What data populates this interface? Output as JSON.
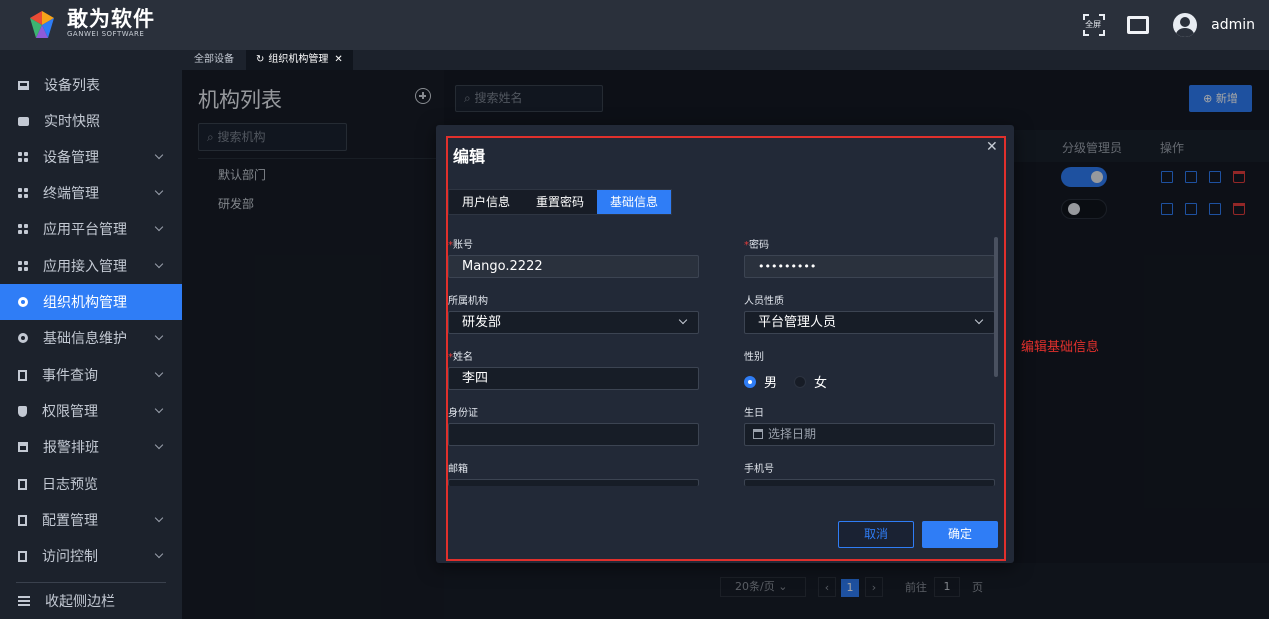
{
  "header": {
    "brand_name": "敢为软件",
    "brand_sub": "GANWEI SOFTWARE",
    "fullscreen_label": "全屏",
    "username": "admin"
  },
  "sidebar": {
    "items": [
      {
        "label": "设备列表",
        "icon": "monitor-icon"
      },
      {
        "label": "实时快照",
        "icon": "camera-icon"
      },
      {
        "label": "设备管理",
        "icon": "grid-icon"
      },
      {
        "label": "终端管理",
        "icon": "grid-icon"
      },
      {
        "label": "应用平台管理",
        "icon": "grid-icon"
      },
      {
        "label": "应用接入管理",
        "icon": "grid-icon"
      },
      {
        "label": "组织机构管理",
        "icon": "gear-icon",
        "active": true
      },
      {
        "label": "基础信息维护",
        "icon": "gear-icon"
      },
      {
        "label": "事件查询",
        "icon": "document-icon"
      },
      {
        "label": "权限管理",
        "icon": "shield-icon"
      },
      {
        "label": "报警排班",
        "icon": "calendar-icon"
      },
      {
        "label": "日志预览",
        "icon": "document-icon"
      },
      {
        "label": "配置管理",
        "icon": "document-icon"
      },
      {
        "label": "访问控制",
        "icon": "document-icon"
      }
    ],
    "collapse_label": "收起侧边栏"
  },
  "tabs": [
    {
      "label": "全部设备"
    },
    {
      "label": "组织机构管理",
      "active": true
    }
  ],
  "org_panel": {
    "title": "机构列表",
    "search_placeholder": "搜索机构",
    "nodes": [
      "默认部门",
      "研发部"
    ]
  },
  "main": {
    "search_placeholder": "搜索姓名",
    "new_button": "新增",
    "columns": [
      "分级管理员",
      "操作"
    ],
    "rows": [
      {
        "level_admin": true
      },
      {
        "level_admin": false
      }
    ],
    "pagination": {
      "page_size": "20条/页",
      "current_page": "1",
      "goto_label": "前往",
      "goto_value": "1",
      "page_suffix": "页"
    }
  },
  "modal": {
    "title": "编辑",
    "tabs": [
      {
        "label": "用户信息"
      },
      {
        "label": "重置密码"
      },
      {
        "label": "基础信息",
        "active": true
      }
    ],
    "fields": {
      "account_label": "账号",
      "account_value": "Mango.2222",
      "password_label": "密码",
      "password_value": "•••••••••",
      "org_label": "所属机构",
      "org_value": "研发部",
      "staff_type_label": "人员性质",
      "staff_type_value": "平台管理人员",
      "name_label": "姓名",
      "name_value": "李四",
      "gender_label": "性别",
      "gender_male": "男",
      "gender_female": "女",
      "id_label": "身份证",
      "id_value": "",
      "birthday_label": "生日",
      "birthday_placeholder": "选择日期",
      "email_label": "邮箱",
      "phone_label": "手机号"
    },
    "cancel_label": "取消",
    "confirm_label": "确定"
  },
  "annotation": "编辑基础信息",
  "colors": {
    "accent": "#2f7df6",
    "danger": "#e23c3c",
    "annotation": "#e0302c"
  }
}
